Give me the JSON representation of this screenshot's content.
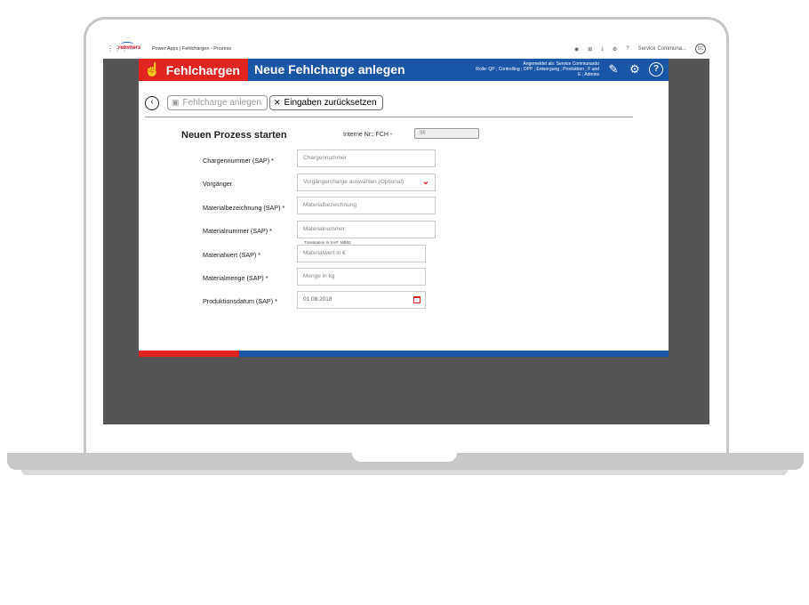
{
  "powerapps": {
    "logo": "remmers",
    "title": "Power Apps | Fehlchargen - Prozess",
    "user": "Service Communa...",
    "avatar": "SC"
  },
  "header": {
    "brand": "Fehlchargen",
    "page_title": "Neue Fehlcharge anlegen",
    "login_line1": "Angemeldet als: Service Communardo",
    "login_line2": "Rolle: QP ; Controlling ; OPP ; Entsorgung ; Produktion ; F und",
    "login_line3": "E ; Admins"
  },
  "toolbar": {
    "save_label": "Fehlcharge anlegen",
    "reset_label": "Eingaben zurücksetzen"
  },
  "form": {
    "section_title": "Neuen Prozess starten",
    "intern_label": "Interne Nr.: FCH -",
    "intern_value": "96",
    "fields": [
      {
        "label": "Chargennummer (SAP) *",
        "placeholder": "Chargennummer"
      },
      {
        "label": "Vorgänger",
        "placeholder": "Vorgängercharge auswählen (Optional)"
      },
      {
        "label": "Materialbezeichnung (SAP) *",
        "placeholder": "Materialbezeichnung"
      },
      {
        "label": "Materialnummer (SAP) *",
        "placeholder": "Materialnummer"
      },
      {
        "label": "Materialwert (SAP) *",
        "placeholder": "Materialwert in €",
        "legend": "Transkation in SAP: MB52"
      },
      {
        "label": "Materialmenge (SAP) *",
        "placeholder": "Menge in kg"
      },
      {
        "label": "Produktionsdatum (SAP) *",
        "value": "01.08.2018"
      }
    ]
  },
  "colors": {
    "brand_red": "#e0241f",
    "brand_blue": "#1957a6"
  },
  "icons": {
    "back": "back-arrow-icon",
    "save": "save-icon",
    "reset": "close-icon",
    "edit": "edit-icon",
    "settings": "gear-icon",
    "help": "help-icon",
    "dropdown": "chevron-down-icon",
    "date": "calendar-icon"
  }
}
